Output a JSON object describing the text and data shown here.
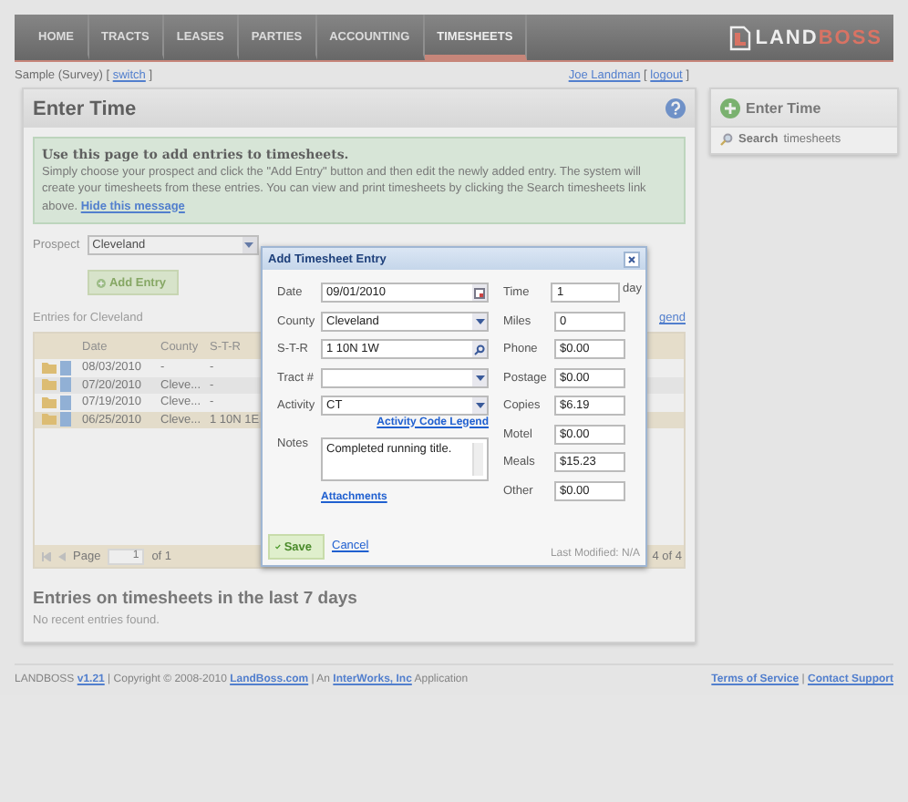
{
  "nav": {
    "items": [
      {
        "label": "HOME",
        "selected": false
      },
      {
        "label": "TRACTS",
        "selected": false
      },
      {
        "label": "LEASES",
        "selected": false
      },
      {
        "label": "PARTIES",
        "selected": false
      },
      {
        "label": "ACCOUNTING",
        "selected": false
      },
      {
        "label": "TIMESHEETS",
        "selected": true
      }
    ],
    "logo": {
      "first": "LAND",
      "second": "BOSS"
    }
  },
  "account": {
    "name": "Sample (Survey) [",
    "switch": "switch",
    "switch_close": "]",
    "user": "Joe Landman",
    "logout_open": "[",
    "logout": "logout",
    "logout_close": "]"
  },
  "panel": {
    "title": "Enter Time",
    "message": {
      "heading": "Use this page to add entries to timesheets.",
      "body": "Simply choose your prospect and click the \"Add Entry\" button and then edit the newly added entry. The system will create your timesheets from these entries. You can view and print timesheets by clicking the Search timesheets link above.",
      "hide": "Hide this message"
    },
    "prospect": {
      "label": "Prospect",
      "value": "Cleveland"
    },
    "add_button": "Add Entry",
    "entries_label": "Entries for Cleveland",
    "legend_fragment": "gend",
    "table": {
      "columns": [
        "Date",
        "County",
        "S-T-R"
      ],
      "rows": [
        {
          "cells": [
            "08/03/2010",
            "-",
            "-"
          ],
          "selected": false
        },
        {
          "cells": [
            "07/20/2010",
            "Cleve...",
            "-"
          ],
          "selected": false
        },
        {
          "cells": [
            "07/19/2010",
            "Cleve...",
            "-"
          ],
          "selected": false
        },
        {
          "cells": [
            "06/25/2010",
            "Cleve...",
            "1 10N 1E"
          ],
          "selected": true
        }
      ]
    },
    "pager": {
      "page_label": "Page",
      "page": "1",
      "of": "of 1",
      "count": "4 of 4"
    },
    "recent": {
      "title": "Entries on timesheets in the last 7 days",
      "empty": "No recent entries found."
    }
  },
  "sidebar": {
    "items": [
      {
        "kind": "add",
        "label": "Enter Time"
      },
      {
        "kind": "search",
        "label": "**Search** timesheets"
      }
    ]
  },
  "dialog": {
    "title": "Add Timesheet Entry",
    "left_fields": [
      {
        "label": "Date",
        "value": "09/01/2010",
        "kind": "date"
      },
      {
        "label": "County",
        "value": "Cleveland",
        "kind": "select"
      },
      {
        "label": "S-T-R",
        "value": "1 10N 1W",
        "kind": "lookup"
      },
      {
        "label": "Tract #",
        "kind": "select"
      },
      {
        "label": "Activity",
        "value": "CT",
        "kind": "select"
      }
    ],
    "legend_link": "Activity Code Legend",
    "notes": {
      "label": "Notes",
      "value": "Completed running title."
    },
    "attachments": "Attachments",
    "right_fields": [
      {
        "label": "Time",
        "value": "1",
        "unit": "day"
      },
      {
        "label": "Miles",
        "value": "0"
      },
      {
        "label": "Phone",
        "value": "$0.00"
      },
      {
        "label": "Postage",
        "value": "$0.00"
      },
      {
        "label": "Copies",
        "value": "$6.19"
      },
      {
        "label": "Motel",
        "value": "$0.00"
      },
      {
        "label": "Meals",
        "value": "$15.23"
      },
      {
        "label": "Other",
        "value": "$0.00"
      }
    ],
    "save": "Save",
    "cancel": "Cancel",
    "modified": "Last Modified: N/A"
  },
  "footer": {
    "brand": "LANDBOSS",
    "version": "v1.21",
    "copyright": "| Copyright © 2008-2010",
    "site": "LandBoss.com",
    "company_prefix": "| An",
    "company": "InterWorks, Inc",
    "suffix": "Application",
    "links": [
      "Terms of Service",
      "Contact Support"
    ],
    "separator": "|"
  }
}
